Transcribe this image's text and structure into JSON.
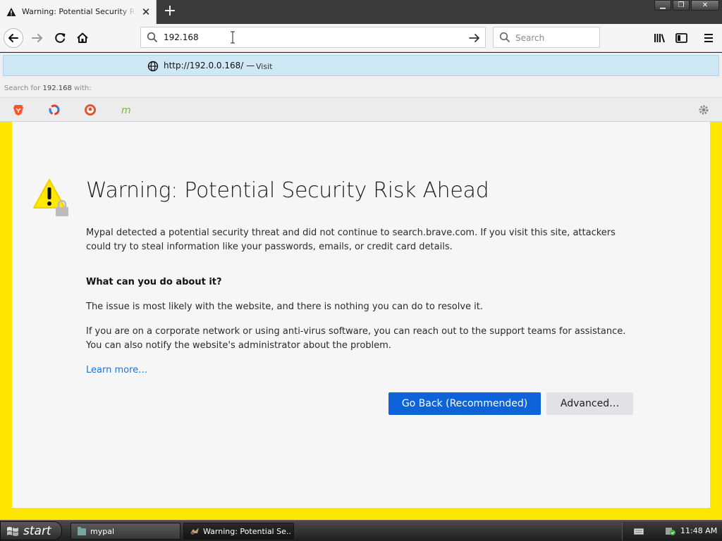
{
  "browser": {
    "tab": {
      "title": "Warning: Potential Security Risk Ahead",
      "warning_icon": "warning-triangle-icon"
    },
    "address_bar": {
      "value": "192.168"
    },
    "search_box": {
      "placeholder": "Search"
    },
    "dropdown": {
      "suggestion_url": "http://192.0.0.168/",
      "suggestion_separator": "—",
      "suggestion_action": "Visit",
      "search_for_prefix": "Search for",
      "search_for_term": "192.168",
      "search_for_suffix": "with:",
      "engines": [
        "brave-icon",
        "qwant-icon",
        "duckduckgo-icon",
        "mojeek-icon"
      ]
    }
  },
  "page": {
    "heading": "Warning: Potential Security Risk Ahead",
    "intro": "Mypal detected a potential security threat and did not continue to search.brave.com. If you visit this site, attackers could try to steal information like your passwords, emails, or credit card details.",
    "subheading": "What can you do about it?",
    "para1": "The issue is most likely with the website, and there is nothing you can do to resolve it.",
    "para2": "If you are on a corporate network or using anti-virus software, you can reach out to the support teams for assistance. You can also notify the website's administrator about the problem.",
    "learn_more": "Learn more…",
    "go_back_button": "Go Back (Recommended)",
    "advanced_button": "Advanced…"
  },
  "taskbar": {
    "start_label": "start",
    "tasks": [
      {
        "label": "mypal"
      },
      {
        "label": "Warning: Potential Se..."
      }
    ],
    "clock": "11:48 AM"
  },
  "colors": {
    "frame_border": "#ffe600",
    "primary_button": "#0f63d8",
    "link": "#1b74d6",
    "suggest_highlight": "#cfe8f5"
  }
}
